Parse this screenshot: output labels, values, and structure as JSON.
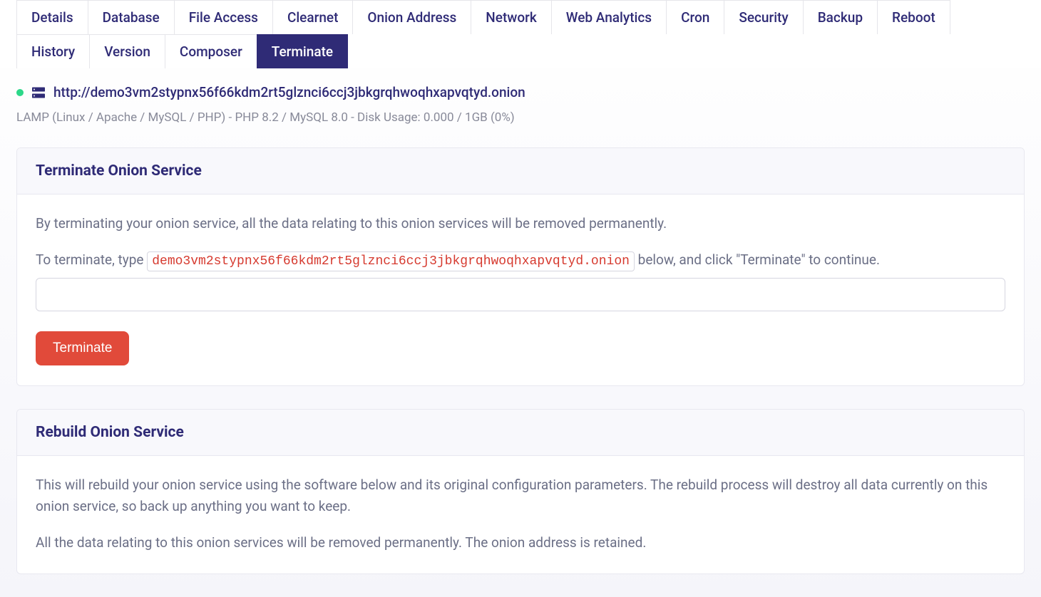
{
  "tabs": {
    "row1": [
      {
        "label": "Details"
      },
      {
        "label": "Database"
      },
      {
        "label": "File Access"
      },
      {
        "label": "Clearnet"
      },
      {
        "label": "Onion Address"
      },
      {
        "label": "Network"
      },
      {
        "label": "Web Analytics"
      },
      {
        "label": "Cron"
      },
      {
        "label": "Security"
      },
      {
        "label": "Backup"
      },
      {
        "label": "Reboot"
      }
    ],
    "row2": [
      {
        "label": "History"
      },
      {
        "label": "Version"
      },
      {
        "label": "Composer"
      },
      {
        "label": "Terminate",
        "active": true
      }
    ]
  },
  "service": {
    "url": "http://demo3vm2stypnx56f66kdm2rt5glznci6ccj3jbkgrqhwoqhxapvqtyd.onion",
    "onion_address": "demo3vm2stypnx56f66kdm2rt5glznci6ccj3jbkgrqhwoqhxapvqtyd.onion",
    "meta": "LAMP (Linux / Apache / MySQL / PHP) - PHP 8.2 / MySQL 8.0 - Disk Usage: 0.000 / 1GB (0%)"
  },
  "terminate_card": {
    "title": "Terminate Onion Service",
    "description": "By terminating your onion service, all the data relating to this onion services will be removed permanently.",
    "prompt_before": "To terminate, type ",
    "prompt_after": " below, and click \"Terminate\" to continue.",
    "input_value": "",
    "button_label": "Terminate"
  },
  "rebuild_card": {
    "title": "Rebuild Onion Service",
    "p1": "This will rebuild your onion service using the software below and its original configuration parameters. The rebuild process will destroy all data currently on this onion service, so back up anything you want to keep.",
    "p2": "All the data relating to this onion services will be removed permanently. The onion address is retained."
  }
}
